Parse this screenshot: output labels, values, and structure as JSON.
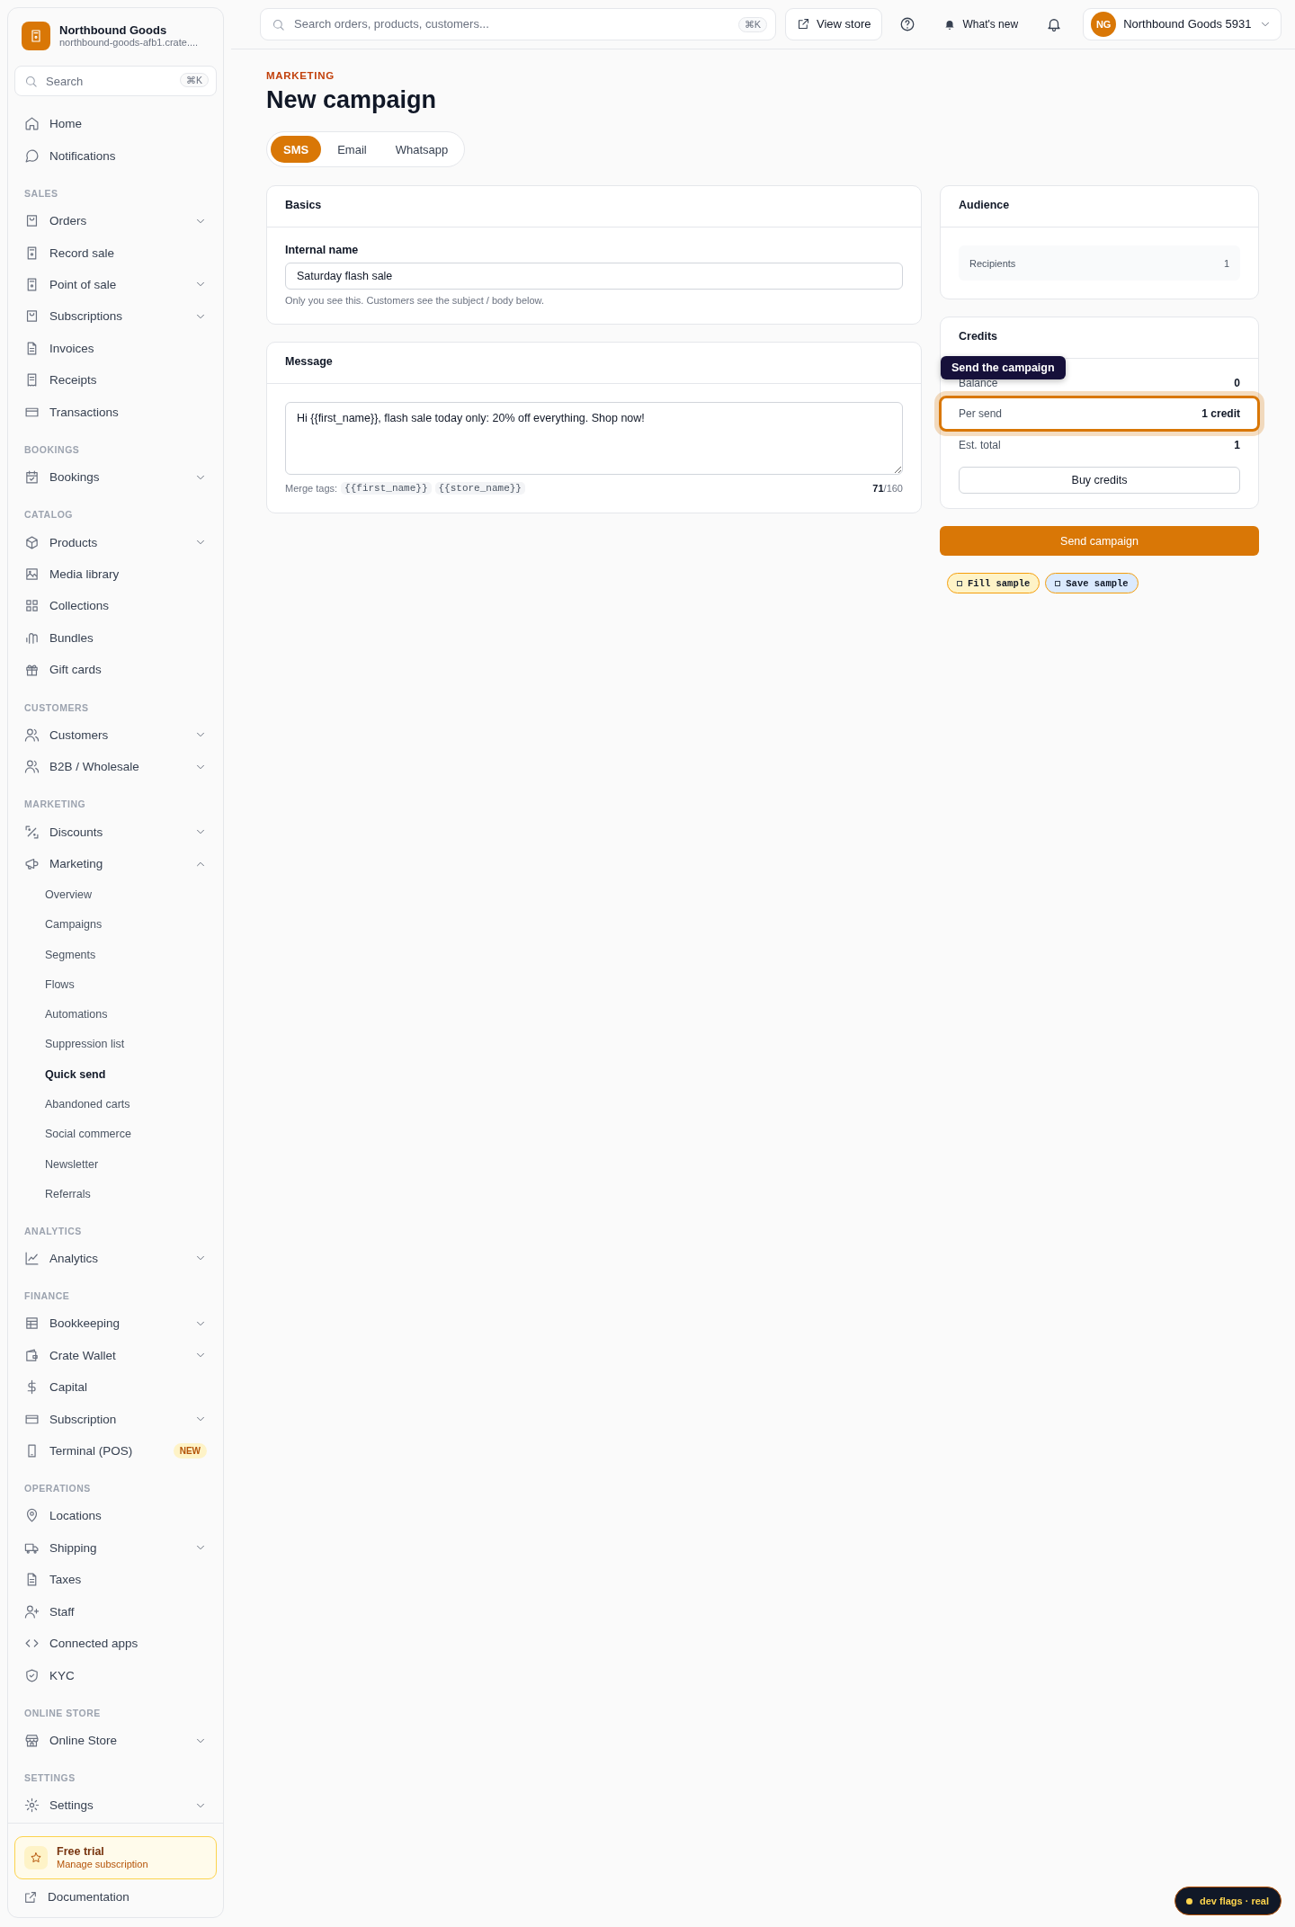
{
  "brand": {
    "name": "Northbound Goods",
    "subtitle": "northbound-goods-afb1.crate...."
  },
  "sidebar": {
    "search": {
      "placeholder": "Search",
      "shortcut": "⌘K"
    },
    "sections": [
      {
        "items": [
          {
            "label": "Home",
            "kind": "link",
            "selected": false
          },
          {
            "label": "Notifications",
            "kind": "link",
            "selected": false
          }
        ]
      },
      {
        "heading": "SALES",
        "items": [
          {
            "label": "Orders",
            "kind": "group",
            "expanded": false,
            "selected": false
          },
          {
            "label": "Record sale",
            "kind": "link",
            "selected": false
          },
          {
            "label": "Point of sale",
            "kind": "group",
            "expanded": false,
            "selected": false
          },
          {
            "label": "Subscriptions",
            "kind": "group",
            "expanded": false,
            "selected": false
          },
          {
            "label": "Invoices",
            "kind": "link",
            "selected": false
          },
          {
            "label": "Receipts",
            "kind": "link",
            "selected": false
          },
          {
            "label": "Transactions",
            "kind": "link",
            "selected": false
          }
        ]
      },
      {
        "heading": "BOOKINGS",
        "items": [
          {
            "label": "Bookings",
            "kind": "group",
            "expanded": false,
            "selected": false
          }
        ]
      },
      {
        "heading": "CATALOG",
        "items": [
          {
            "label": "Products",
            "kind": "group",
            "expanded": false,
            "selected": false
          },
          {
            "label": "Media library",
            "kind": "link",
            "selected": false
          },
          {
            "label": "Collections",
            "kind": "link",
            "selected": false
          },
          {
            "label": "Bundles",
            "kind": "link",
            "selected": false
          },
          {
            "label": "Gift cards",
            "kind": "link",
            "selected": false
          }
        ]
      },
      {
        "heading": "CUSTOMERS",
        "items": [
          {
            "label": "Customers",
            "kind": "group",
            "expanded": false,
            "selected": false
          },
          {
            "label": "B2B / Wholesale",
            "kind": "group",
            "expanded": false,
            "selected": false
          }
        ]
      },
      {
        "heading": "MARKETING",
        "items": [
          {
            "label": "Discounts",
            "kind": "group",
            "expanded": false,
            "selected": false
          },
          {
            "label": "Marketing",
            "kind": "group",
            "expanded": true,
            "selected": false,
            "children": [
              {
                "label": "Overview",
                "selected": false
              },
              {
                "label": "Campaigns",
                "selected": false
              },
              {
                "label": "Segments",
                "selected": false
              },
              {
                "label": "Flows",
                "selected": false
              },
              {
                "label": "Automations",
                "selected": false
              },
              {
                "label": "Suppression list",
                "selected": false
              },
              {
                "label": "Quick send",
                "selected": true
              },
              {
                "label": "Abandoned carts",
                "selected": false
              },
              {
                "label": "Social commerce",
                "selected": false
              },
              {
                "label": "Newsletter",
                "selected": false
              },
              {
                "label": "Referrals",
                "selected": false
              }
            ]
          }
        ]
      },
      {
        "heading": "ANALYTICS",
        "items": [
          {
            "label": "Analytics",
            "kind": "group",
            "expanded": false,
            "selected": false
          }
        ]
      },
      {
        "heading": "FINANCE",
        "items": [
          {
            "label": "Bookkeeping",
            "kind": "group",
            "expanded": false,
            "selected": false
          },
          {
            "label": "Crate Wallet",
            "kind": "group",
            "expanded": false,
            "selected": false
          },
          {
            "label": "Capital",
            "kind": "link",
            "selected": false
          },
          {
            "label": "Subscription",
            "kind": "group",
            "expanded": false,
            "selected": false
          },
          {
            "label": "Terminal (POS)",
            "kind": "link",
            "selected": false,
            "badge": "NEW"
          }
        ]
      },
      {
        "heading": "OPERATIONS",
        "items": [
          {
            "label": "Locations",
            "kind": "link",
            "selected": false
          },
          {
            "label": "Shipping",
            "kind": "group",
            "expanded": false,
            "selected": false
          },
          {
            "label": "Taxes",
            "kind": "link",
            "selected": false
          },
          {
            "label": "Staff",
            "kind": "link",
            "selected": false
          },
          {
            "label": "Connected apps",
            "kind": "link",
            "selected": false
          },
          {
            "label": "KYC",
            "kind": "link",
            "selected": false
          }
        ]
      },
      {
        "heading": "ONLINE STORE",
        "items": [
          {
            "label": "Online Store",
            "kind": "group",
            "expanded": false,
            "selected": false
          }
        ]
      },
      {
        "heading": "SETTINGS",
        "items": [
          {
            "label": "Settings",
            "kind": "group",
            "expanded": false,
            "selected": false
          }
        ]
      }
    ],
    "trial": {
      "title": "Free trial",
      "link": "Manage subscription"
    },
    "footer_link": "Documentation"
  },
  "top_bar": {
    "search": {
      "placeholder": "Search orders, products, customers...",
      "shortcut": "⌘K"
    },
    "view_store": "View store",
    "whats_new": "What's new",
    "account": {
      "initials": "NG",
      "name": "Northbound Goods 5931"
    }
  },
  "page": {
    "eyebrow": "MARKETING",
    "title": "New campaign",
    "channels": [
      {
        "label": "SMS",
        "selected": true
      },
      {
        "label": "Email",
        "selected": false
      },
      {
        "label": "Whatsapp",
        "selected": false
      }
    ],
    "basics": {
      "title": "Basics",
      "field_label": "Internal name",
      "value": "Saturday flash sale",
      "hint": "Only you see this. Customers see the subject / body below."
    },
    "message": {
      "title": "Message",
      "value": "Hi {{first_name}}, flash sale today only: 20% off everything. Shop now!",
      "merge_label": "Merge tags:",
      "merge_tags": [
        "{{first_name}}",
        "{{store_name}}"
      ],
      "counter": "**71**/160"
    },
    "audience": {
      "title": "Audience",
      "rows": [
        {
          "label": "Recipients",
          "value": "1"
        }
      ]
    },
    "credits": {
      "title": "Credits",
      "rows": [
        {
          "label": "Balance",
          "value": "0",
          "highlighted": false
        },
        {
          "label": "Per send",
          "value": "1 credit",
          "highlighted": true
        },
        {
          "label": "Est. total",
          "value": "1",
          "highlighted": false
        }
      ],
      "button": "Buy credits",
      "tooltip": "Send the campaign"
    },
    "send_button": "Send campaign",
    "dev_actions": [
      {
        "label": "Fill sample",
        "color": "#fef3c7"
      },
      {
        "label": "Save sample",
        "color": "#dbeafe"
      }
    ]
  },
  "dev_flags": {
    "label": "dev flags · real"
  }
}
